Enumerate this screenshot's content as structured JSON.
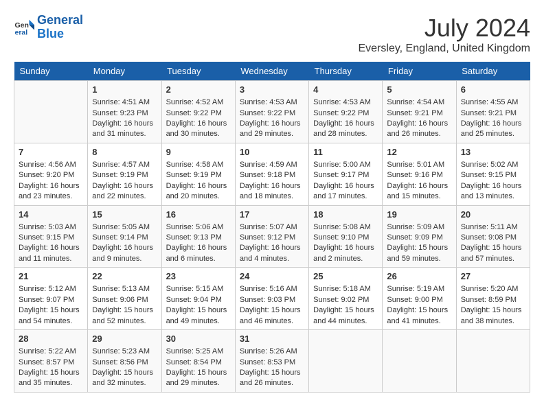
{
  "header": {
    "logo_line1": "General",
    "logo_line2": "Blue",
    "month_year": "July 2024",
    "location": "Eversley, England, United Kingdom"
  },
  "days_of_week": [
    "Sunday",
    "Monday",
    "Tuesday",
    "Wednesday",
    "Thursday",
    "Friday",
    "Saturday"
  ],
  "weeks": [
    [
      {
        "day": "",
        "info": ""
      },
      {
        "day": "1",
        "info": "Sunrise: 4:51 AM\nSunset: 9:23 PM\nDaylight: 16 hours\nand 31 minutes."
      },
      {
        "day": "2",
        "info": "Sunrise: 4:52 AM\nSunset: 9:22 PM\nDaylight: 16 hours\nand 30 minutes."
      },
      {
        "day": "3",
        "info": "Sunrise: 4:53 AM\nSunset: 9:22 PM\nDaylight: 16 hours\nand 29 minutes."
      },
      {
        "day": "4",
        "info": "Sunrise: 4:53 AM\nSunset: 9:22 PM\nDaylight: 16 hours\nand 28 minutes."
      },
      {
        "day": "5",
        "info": "Sunrise: 4:54 AM\nSunset: 9:21 PM\nDaylight: 16 hours\nand 26 minutes."
      },
      {
        "day": "6",
        "info": "Sunrise: 4:55 AM\nSunset: 9:21 PM\nDaylight: 16 hours\nand 25 minutes."
      }
    ],
    [
      {
        "day": "7",
        "info": "Sunrise: 4:56 AM\nSunset: 9:20 PM\nDaylight: 16 hours\nand 23 minutes."
      },
      {
        "day": "8",
        "info": "Sunrise: 4:57 AM\nSunset: 9:19 PM\nDaylight: 16 hours\nand 22 minutes."
      },
      {
        "day": "9",
        "info": "Sunrise: 4:58 AM\nSunset: 9:19 PM\nDaylight: 16 hours\nand 20 minutes."
      },
      {
        "day": "10",
        "info": "Sunrise: 4:59 AM\nSunset: 9:18 PM\nDaylight: 16 hours\nand 18 minutes."
      },
      {
        "day": "11",
        "info": "Sunrise: 5:00 AM\nSunset: 9:17 PM\nDaylight: 16 hours\nand 17 minutes."
      },
      {
        "day": "12",
        "info": "Sunrise: 5:01 AM\nSunset: 9:16 PM\nDaylight: 16 hours\nand 15 minutes."
      },
      {
        "day": "13",
        "info": "Sunrise: 5:02 AM\nSunset: 9:15 PM\nDaylight: 16 hours\nand 13 minutes."
      }
    ],
    [
      {
        "day": "14",
        "info": "Sunrise: 5:03 AM\nSunset: 9:15 PM\nDaylight: 16 hours\nand 11 minutes."
      },
      {
        "day": "15",
        "info": "Sunrise: 5:05 AM\nSunset: 9:14 PM\nDaylight: 16 hours\nand 9 minutes."
      },
      {
        "day": "16",
        "info": "Sunrise: 5:06 AM\nSunset: 9:13 PM\nDaylight: 16 hours\nand 6 minutes."
      },
      {
        "day": "17",
        "info": "Sunrise: 5:07 AM\nSunset: 9:12 PM\nDaylight: 16 hours\nand 4 minutes."
      },
      {
        "day": "18",
        "info": "Sunrise: 5:08 AM\nSunset: 9:10 PM\nDaylight: 16 hours\nand 2 minutes."
      },
      {
        "day": "19",
        "info": "Sunrise: 5:09 AM\nSunset: 9:09 PM\nDaylight: 15 hours\nand 59 minutes."
      },
      {
        "day": "20",
        "info": "Sunrise: 5:11 AM\nSunset: 9:08 PM\nDaylight: 15 hours\nand 57 minutes."
      }
    ],
    [
      {
        "day": "21",
        "info": "Sunrise: 5:12 AM\nSunset: 9:07 PM\nDaylight: 15 hours\nand 54 minutes."
      },
      {
        "day": "22",
        "info": "Sunrise: 5:13 AM\nSunset: 9:06 PM\nDaylight: 15 hours\nand 52 minutes."
      },
      {
        "day": "23",
        "info": "Sunrise: 5:15 AM\nSunset: 9:04 PM\nDaylight: 15 hours\nand 49 minutes."
      },
      {
        "day": "24",
        "info": "Sunrise: 5:16 AM\nSunset: 9:03 PM\nDaylight: 15 hours\nand 46 minutes."
      },
      {
        "day": "25",
        "info": "Sunrise: 5:18 AM\nSunset: 9:02 PM\nDaylight: 15 hours\nand 44 minutes."
      },
      {
        "day": "26",
        "info": "Sunrise: 5:19 AM\nSunset: 9:00 PM\nDaylight: 15 hours\nand 41 minutes."
      },
      {
        "day": "27",
        "info": "Sunrise: 5:20 AM\nSunset: 8:59 PM\nDaylight: 15 hours\nand 38 minutes."
      }
    ],
    [
      {
        "day": "28",
        "info": "Sunrise: 5:22 AM\nSunset: 8:57 PM\nDaylight: 15 hours\nand 35 minutes."
      },
      {
        "day": "29",
        "info": "Sunrise: 5:23 AM\nSunset: 8:56 PM\nDaylight: 15 hours\nand 32 minutes."
      },
      {
        "day": "30",
        "info": "Sunrise: 5:25 AM\nSunset: 8:54 PM\nDaylight: 15 hours\nand 29 minutes."
      },
      {
        "day": "31",
        "info": "Sunrise: 5:26 AM\nSunset: 8:53 PM\nDaylight: 15 hours\nand 26 minutes."
      },
      {
        "day": "",
        "info": ""
      },
      {
        "day": "",
        "info": ""
      },
      {
        "day": "",
        "info": ""
      }
    ]
  ]
}
